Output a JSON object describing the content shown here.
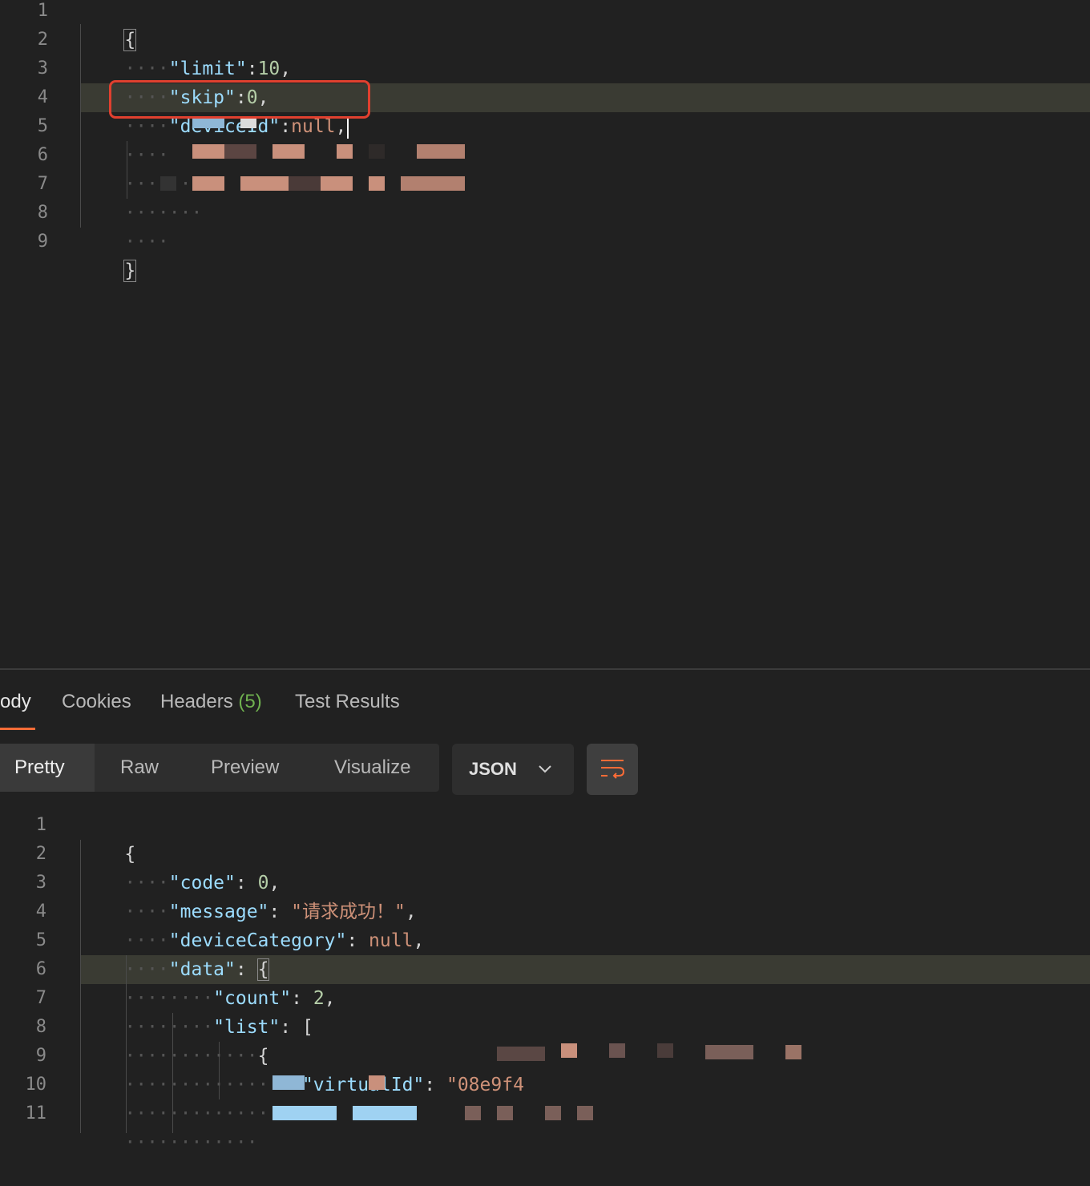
{
  "editor": {
    "line_numbers": [
      "1",
      "2",
      "3",
      "4",
      "5",
      "6",
      "7",
      "8",
      "9"
    ],
    "lines": {
      "l1": "{",
      "l2_key": "\"limit\"",
      "l2_colon": ":",
      "l2_val": "10",
      "l2_end": ",",
      "l3_key": "\"skip\"",
      "l3_colon": ":",
      "l3_val": "0",
      "l3_end": ",",
      "l4_key": "\"deviceId\"",
      "l4_colon": ":",
      "l4_val": "null",
      "l4_end": ",",
      "l9": "}"
    },
    "highlight_color": "#e0402f"
  },
  "response": {
    "tabs": {
      "body": "ody",
      "cookies": "Cookies",
      "headers": "Headers",
      "headers_count": "(5)",
      "test_results": "Test Results"
    },
    "view_modes": {
      "pretty": "Pretty",
      "raw": "Raw",
      "preview": "Preview",
      "visualize": "Visualize"
    },
    "format": {
      "selected": "JSON"
    },
    "wrap_icon": "wrap-lines-icon",
    "line_numbers": [
      "1",
      "2",
      "3",
      "4",
      "5",
      "6",
      "7",
      "8",
      "9",
      "10",
      "11"
    ],
    "lines": {
      "r1": "{",
      "r2_key": "\"code\"",
      "r2_val": "0",
      "r3_key": "\"message\"",
      "r3_val": "\"请求成功！\"",
      "r4_key": "\"deviceCategory\"",
      "r4_val": "null",
      "r5_key": "\"data\"",
      "r5_open": "{",
      "r6_key": "\"count\"",
      "r6_val": "2",
      "r7_key": "\"list\"",
      "r7_open": "[",
      "r8_open": "{",
      "r9_key": "\"virtualId\"",
      "r9_val": "\"08e9f4"
    },
    "accent_color": "#ff6c37"
  }
}
